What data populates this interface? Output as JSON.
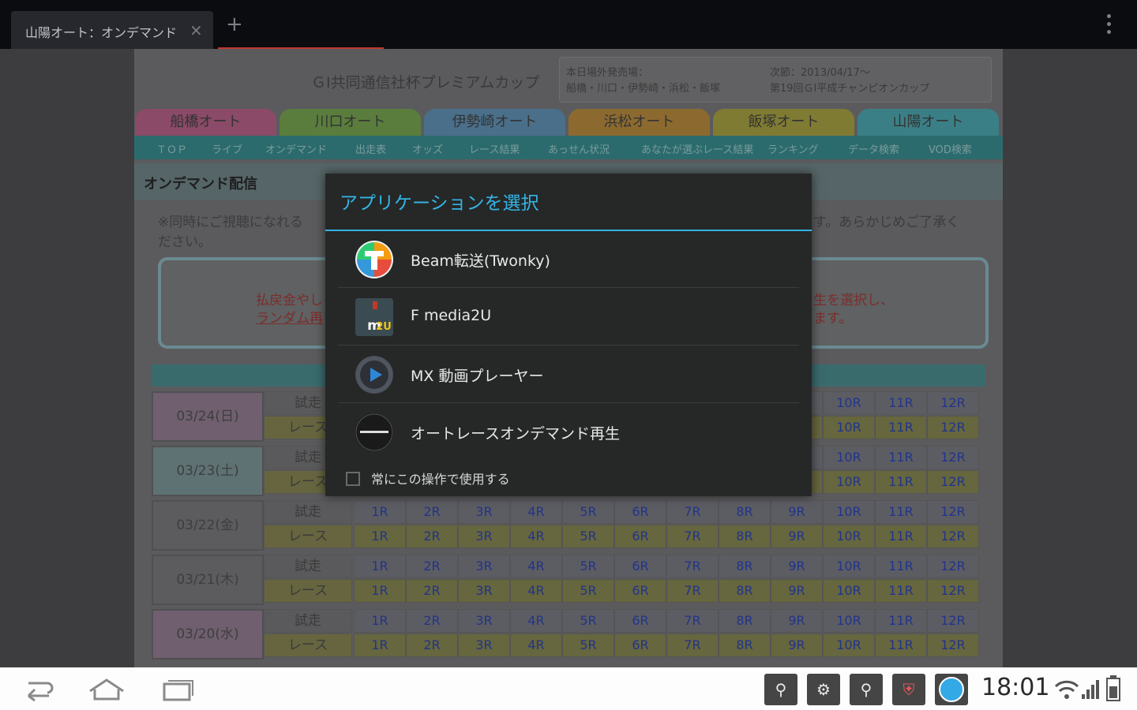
{
  "browser": {
    "tab_title": "山陽オート：オンデマンド",
    "close_glyph": "×",
    "new_tab_glyph": "+"
  },
  "site": {
    "title": "ＧⅠ共同通信社杯プレミアムカップ",
    "info_left_1": "本日場外発売場：",
    "info_left_2": "船橋・川口・伊勢崎・浜松・飯塚",
    "info_right_1": "次節：2013/04/17〜",
    "info_right_2": "第19回ＧⅠ平成チャンピオンカップ",
    "nav_tabs": [
      "船橋オート",
      "川口オート",
      "伊勢崎オート",
      "浜松オート",
      "飯塚オート",
      "山陽オート"
    ],
    "nav_colors": [
      "#8a4a68",
      "#5a7d3d",
      "#4a6f8a",
      "#8c6a2f",
      "#807b33",
      "#3b7f86"
    ],
    "subnav": [
      "ＴＯＰ",
      "ライブ",
      "オンデマンド",
      "出走表",
      "オッズ",
      "レース結果",
      "あっせん状況",
      "あなたが選ぶレース結果",
      "ランキング",
      "データ検索",
      "VOD検索"
    ],
    "section_title": "オンデマンド配信",
    "notice_left": "※同時にご視聴になれる",
    "notice_right": "す。あらかじめご了承く",
    "notice_cont": "ださい。",
    "callout_left": [
      "払戻金やし",
      "ランダム再"
    ],
    "callout_right": [
      "生を選択し、",
      "ます。"
    ],
    "schedule": [
      {
        "date": "03/24(日)",
        "bg": "#6f5f6f"
      },
      {
        "date": "03/23(土)",
        "bg": "#5e7274"
      },
      {
        "date": "03/22(金)",
        "bg": "#5c5c5e"
      },
      {
        "date": "03/21(木)",
        "bg": "#5c5c5e"
      },
      {
        "date": "03/20(水)",
        "bg": "#6f5f6f"
      }
    ],
    "kind_labels": [
      "試走",
      "レース"
    ],
    "race_labels": [
      "1R",
      "2R",
      "3R",
      "4R",
      "5R",
      "6R",
      "7R",
      "8R",
      "9R",
      "10R",
      "11R",
      "12R"
    ]
  },
  "dialog": {
    "title": "アプリケーションを選択",
    "apps": [
      {
        "label": "Beam転送(Twonky)",
        "icon": "twonky-icon"
      },
      {
        "label": "F media2U",
        "icon": "media2u-icon"
      },
      {
        "label": "MX 動画プレーヤー",
        "icon": "mx-player-icon"
      },
      {
        "label": "オートレースオンデマンド再生",
        "icon": "autorace-icon"
      }
    ],
    "always_label": "常にこの操作で使用する"
  },
  "system_bar": {
    "time": "18:01"
  }
}
